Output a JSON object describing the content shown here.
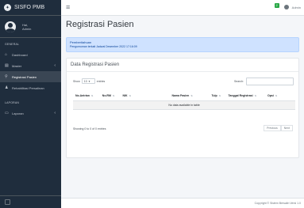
{
  "brand": {
    "name": "SISFO PMB",
    "logo_icon": "seal-logo-icon"
  },
  "user": {
    "line1": "Hai,",
    "line2": "Admin",
    "avatar_icon": "user-avatar-icon"
  },
  "sidebar": {
    "header_general": "GENERAL",
    "header_laporan": "LAPORAN",
    "items": [
      {
        "label": "Dashboard",
        "icon": "home-icon"
      },
      {
        "label": "Master",
        "icon": "database-icon",
        "chevron": "‹"
      },
      {
        "label": "Registrasi Pasien",
        "icon": "user-plus-icon",
        "active": true
      },
      {
        "label": "Rehabilitasi Persalinan",
        "icon": "user-icon"
      },
      {
        "label": "Laporan",
        "icon": "file-icon",
        "chevron": "‹"
      }
    ]
  },
  "topbar": {
    "hamburger_icon": "menu-icon",
    "notif_count": "2",
    "username": "Admin"
  },
  "page": {
    "title": "Registrasi Pasien"
  },
  "alert": {
    "title": "Pemberitahuan",
    "text": "Pengumuman terkait Jadwal Desember 2022 17:16:09"
  },
  "card": {
    "title": "Data Registrasi Pasien",
    "length": {
      "prefix": "Show",
      "value": "10",
      "suffix": "entries"
    },
    "search_label": "Search:",
    "table": {
      "headers": [
        "No.Antrian",
        "No.RM",
        "NIK",
        "Nama Pasien",
        "Tulp",
        "Tanggal Registrasi",
        "Opsi"
      ],
      "empty_text": "No data available in table"
    },
    "info": "Showing 0 to 0 of 0 entries",
    "pager": {
      "previous": "Previous",
      "next": "Next"
    }
  },
  "footer": {
    "text": "Copyright © Sistem Bersalin Versi 1.0"
  },
  "colors": {
    "sidebar_bg": "#1f2d3d",
    "alert_bg": "#cfe2ff",
    "content_bg": "#f4f6f9"
  }
}
